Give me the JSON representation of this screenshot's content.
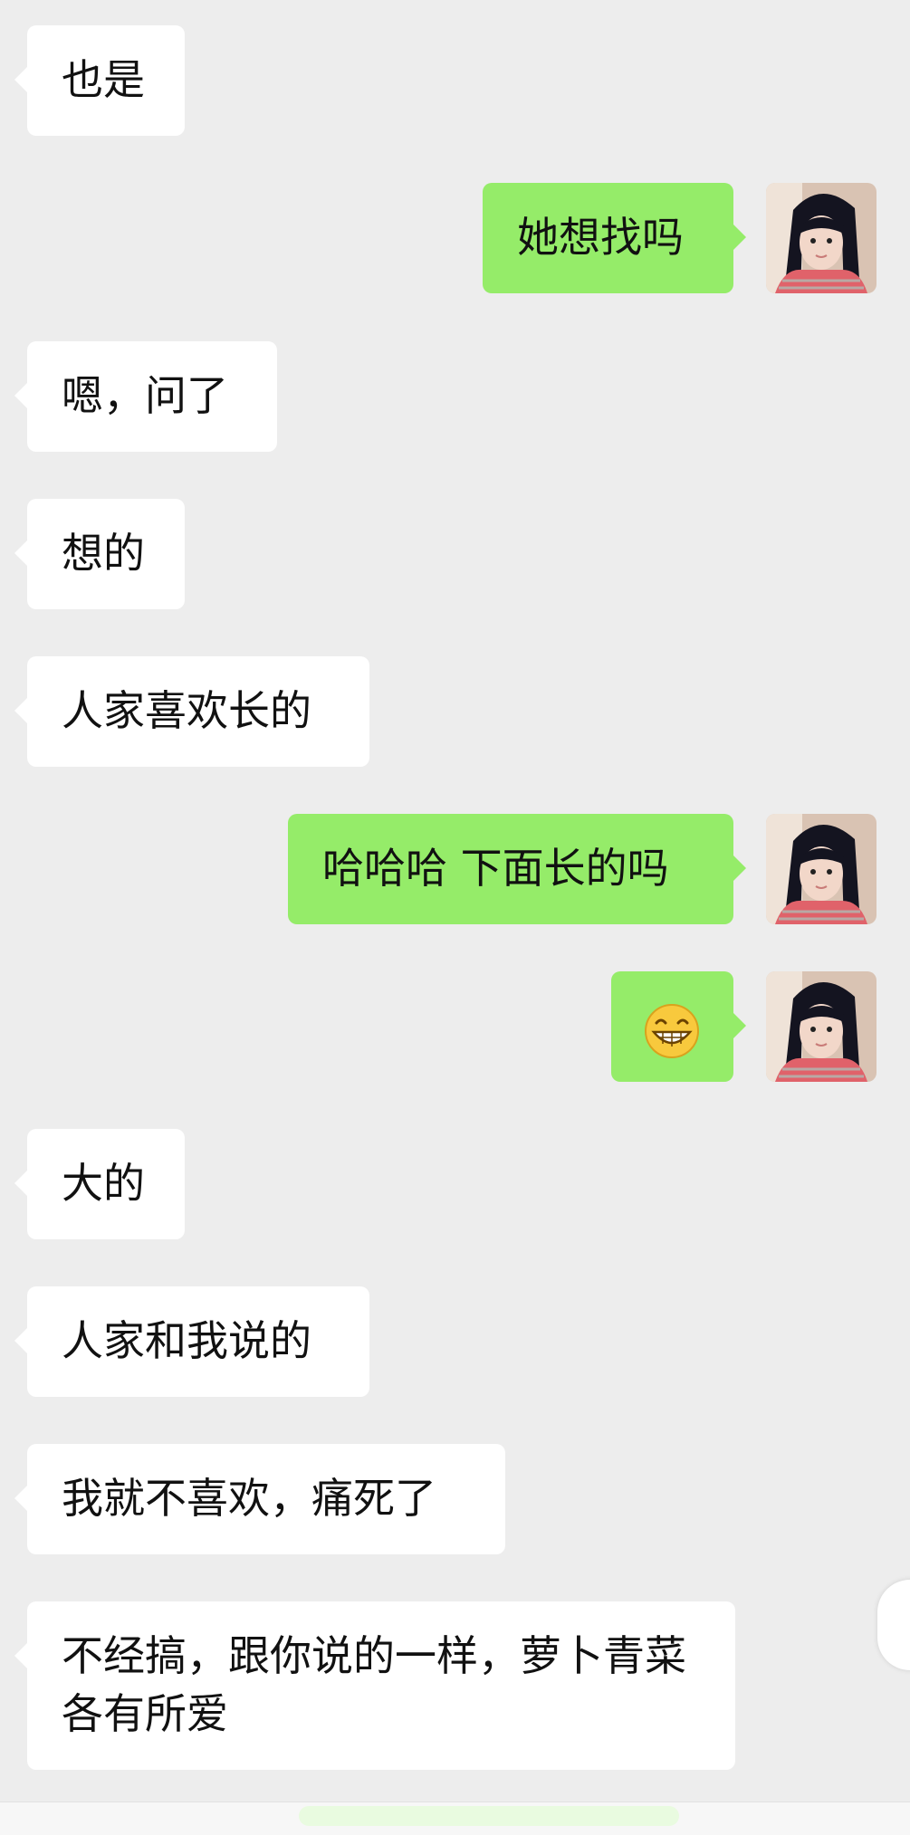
{
  "chat": {
    "messages": [
      {
        "side": "left",
        "text": "也是"
      },
      {
        "side": "right",
        "text": "她想找吗"
      },
      {
        "side": "left",
        "text": "嗯，问了"
      },
      {
        "side": "left",
        "text": "想的"
      },
      {
        "side": "left",
        "text": "人家喜欢长的"
      },
      {
        "side": "right",
        "text": "哈哈哈 下面长的吗"
      },
      {
        "side": "right",
        "emoji": "grinning-emoji"
      },
      {
        "side": "left",
        "text": "大的"
      },
      {
        "side": "left",
        "text": "人家和我说的"
      },
      {
        "side": "left",
        "text": "我就不喜欢，痛死了"
      },
      {
        "side": "left",
        "text": "不经搞，跟你说的一样，萝卜青菜各有所爱"
      }
    ]
  },
  "colors": {
    "background": "#ededed",
    "incoming_bubble": "#ffffff",
    "outgoing_bubble": "#95ec69",
    "text": "#111111"
  },
  "icons": {
    "avatar": "profile-photo-avatar",
    "emoji": "grinning-face-emoji"
  }
}
